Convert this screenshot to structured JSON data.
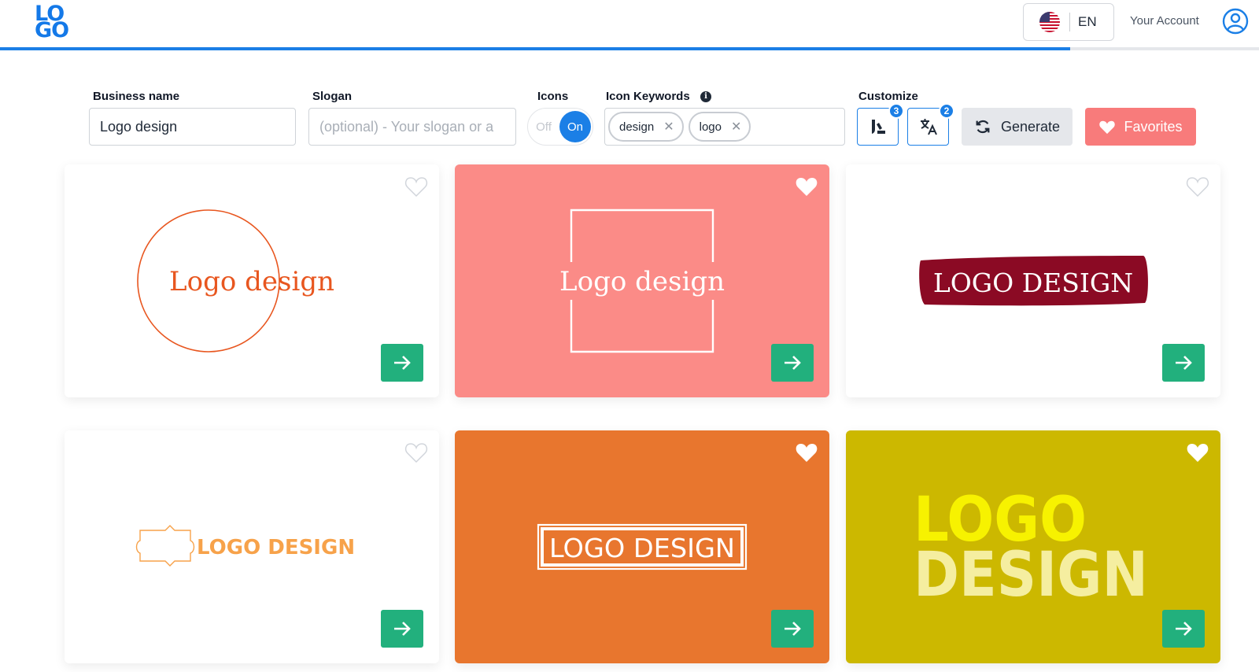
{
  "header": {
    "logo": [
      "LO",
      "GO"
    ],
    "language": "EN",
    "account_label": "Your Account",
    "progress_percent": 85
  },
  "toolbar": {
    "business_name": {
      "label": "Business name",
      "value": "Logo design"
    },
    "slogan": {
      "label": "Slogan",
      "placeholder": "(optional) - Your slogan or a"
    },
    "icons": {
      "label": "Icons",
      "off": "Off",
      "on": "On",
      "state": "on"
    },
    "icon_keywords": {
      "label": "Icon Keywords",
      "info": "i",
      "chips": [
        "design",
        "logo"
      ]
    },
    "customize": {
      "label": "Customize",
      "style_badge": "3",
      "translate_badge": "2"
    },
    "generate_label": "Generate",
    "favorites_label": "Favorites"
  },
  "cards": [
    {
      "text": "Logo design",
      "background": "#ffffff",
      "accent": "#e8561f",
      "favorited": false
    },
    {
      "text": "Logo design",
      "background": "#fb8b87",
      "accent": "#ffffff",
      "favorited": true
    },
    {
      "text": "LOGO DESIGN",
      "background": "#ffffff",
      "accent": "#8b0a24",
      "favorited": false
    },
    {
      "text": "LOGO DESIGN",
      "background": "#ffffff",
      "accent": "#f7a24a",
      "favorited": false
    },
    {
      "text": "LOGO DESIGN",
      "background": "#e8762e",
      "accent": "#ffffff",
      "favorited": true
    },
    {
      "text_lines": [
        "LOGO",
        "DESIGN"
      ],
      "background": "#ccb800",
      "accent": "#f7f200",
      "favorited": true
    }
  ],
  "colors": {
    "brand": "#1479e8",
    "accent": "#1b7fe6",
    "go": "#22b07d",
    "favorites": "#f87b7b"
  }
}
